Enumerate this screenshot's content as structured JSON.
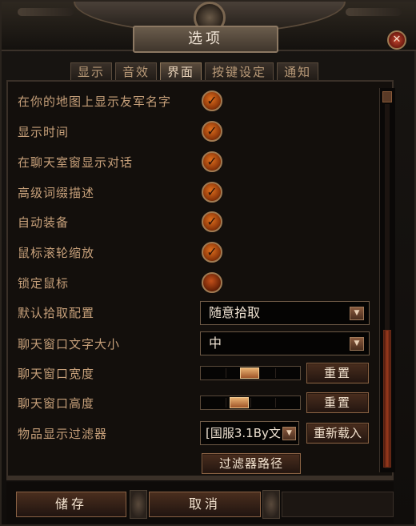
{
  "window": {
    "title": "选项",
    "close_glyph": "✕"
  },
  "tabs": [
    {
      "label": "显示",
      "active": false
    },
    {
      "label": "音效",
      "active": false
    },
    {
      "label": "界面",
      "active": true
    },
    {
      "label": "按键设定",
      "active": false
    },
    {
      "label": "通知",
      "active": false
    }
  ],
  "checkboxes": [
    {
      "label": "在你的地图上显示友军名字",
      "checked": true
    },
    {
      "label": "显示时间",
      "checked": true
    },
    {
      "label": "在聊天室窗显示对话",
      "checked": true
    },
    {
      "label": "高级词缀描述",
      "checked": true
    },
    {
      "label": "自动装备",
      "checked": true
    },
    {
      "label": "鼠标滚轮缩放",
      "checked": true
    },
    {
      "label": "锁定鼠标",
      "checked": false
    }
  ],
  "loot": {
    "label": "默认拾取配置",
    "value": "随意拾取",
    "arrow_icon": "chevron-down-icon"
  },
  "chat_font": {
    "label": "聊天窗口文字大小",
    "value": "中",
    "arrow_icon": "chevron-down-icon"
  },
  "chat_width": {
    "label": "聊天窗口宽度",
    "reset_label": "重置",
    "level": 0.5
  },
  "chat_height": {
    "label": "聊天窗口高度",
    "reset_label": "重置",
    "level": 0.37
  },
  "item_filter": {
    "label": "物品显示过滤器",
    "value": "[国服3.1By文",
    "reload_label": "重新载入",
    "path_label": "过滤器路径"
  },
  "footer": {
    "save_label": "储存",
    "cancel_label": "取消"
  },
  "check_glyph": "✓",
  "accent_color": "#d9661c"
}
